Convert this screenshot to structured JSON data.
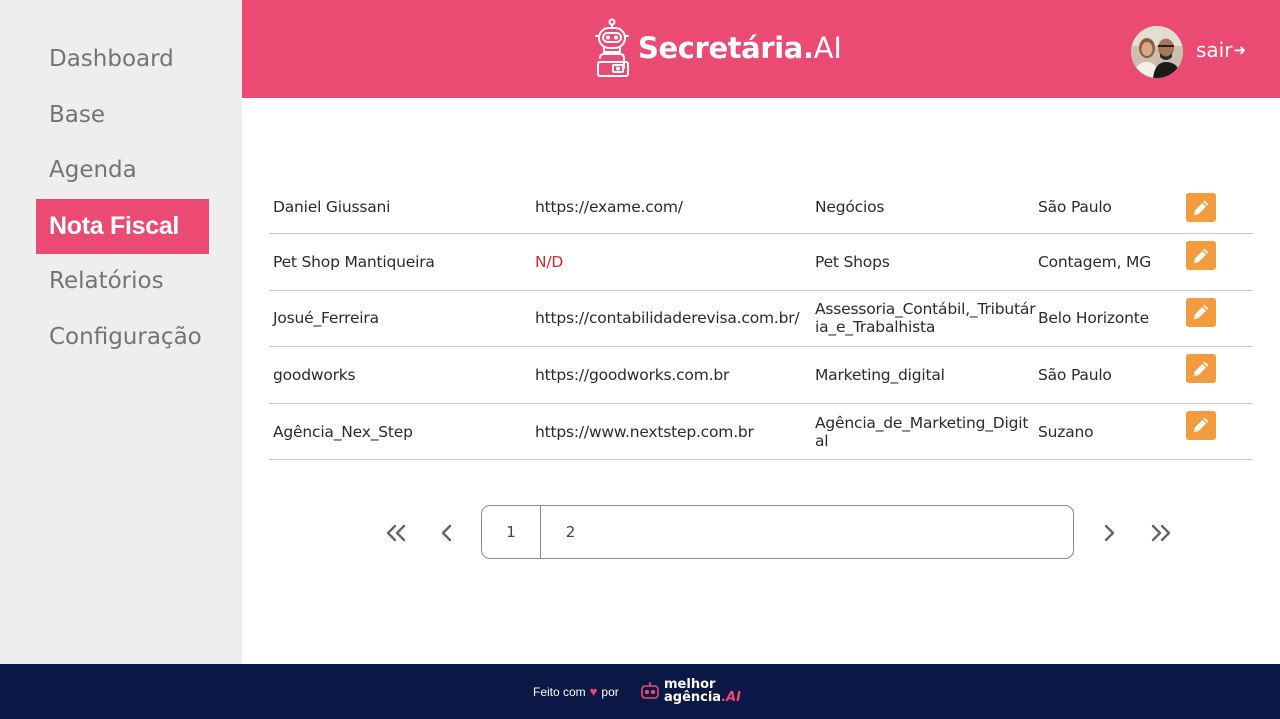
{
  "sidebar": {
    "items": [
      {
        "label": "Dashboard"
      },
      {
        "label": "Base"
      },
      {
        "label": "Agenda"
      },
      {
        "label": "Nota Fiscal",
        "active": true
      },
      {
        "label": "Relatórios"
      },
      {
        "label": "Configuração"
      }
    ]
  },
  "header": {
    "brand_name": "Secretária.",
    "brand_suffix": "AI",
    "logout_label": "sair",
    "logout_icon": "arrow-right-icon"
  },
  "table": {
    "rows": [
      {
        "name": "Daniel Giussani",
        "url": "https://exame.com/",
        "category": "Negócios",
        "city": "São Paulo"
      },
      {
        "name": "Pet Shop Mantiqueira",
        "url": "N/D",
        "category": "Pet Shops",
        "city": "Contagem, MG"
      },
      {
        "name": "Josué_Ferreira",
        "url": "https://contabilidaderevisa.com.br/",
        "category": "Assessoria_Contábil,_Tributária_e_Trabalhista",
        "city": "Belo Horizonte"
      },
      {
        "name": "goodworks",
        "url": "https://goodworks.com.br",
        "category": "Marketing_digital",
        "city": "São Paulo"
      },
      {
        "name": "Agência_Nex_Step",
        "url": "https://www.nextstep.com.br",
        "category": "Agência_de_Marketing_Digital",
        "city": "Suzano"
      }
    ]
  },
  "pagination": {
    "pages": [
      "1",
      "2"
    ],
    "current_page": "1"
  },
  "footer": {
    "made_with": "Feito com",
    "by": "por",
    "logo_line1": "melhor",
    "logo_line2": "agência",
    "logo_ai": ".AI"
  },
  "colors": {
    "accent": "#eb4a73",
    "edit": "#f29b3f",
    "footer_bg": "#0b1845",
    "sidebar_bg": "#eeeeee",
    "nd_text": "#d02b2b"
  }
}
